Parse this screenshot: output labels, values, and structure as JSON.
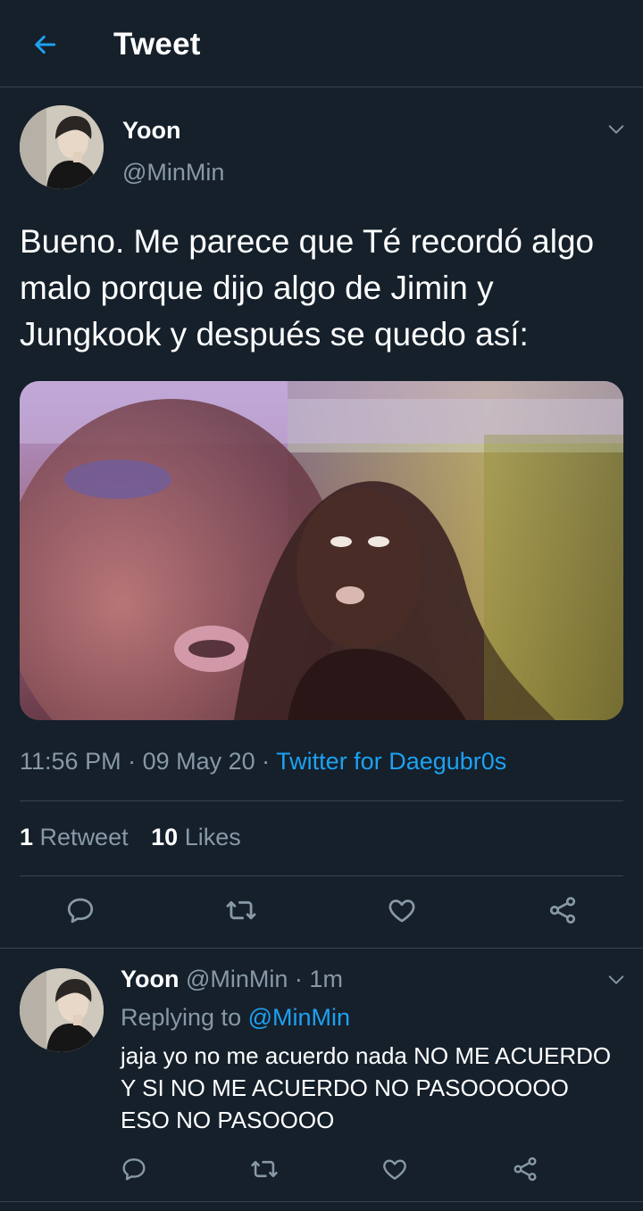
{
  "header": {
    "title": "Tweet"
  },
  "tweet": {
    "author_name": "Yoon",
    "author_handle": "@MinMin",
    "text": "Bueno. Me parece que Té recordó algo malo porque dijo algo de Jimin y Jungkook y después se quedo así:",
    "time": "11:56 PM",
    "date": "09 May 20",
    "source": "Twitter for Daegubr0s",
    "retweets_count": "1",
    "retweets_label": "Retweet",
    "likes_count": "10",
    "likes_label": "Likes"
  },
  "reply": {
    "author_name": "Yoon",
    "author_handle": "@MinMin",
    "time_ago": "1m",
    "replying_label": "Replying to",
    "replying_handle": "@MinMin",
    "text": "jaja yo no me acuerdo nada NO ME ACUERDO Y SI NO ME ACUERDO NO PASOOOOOO ESO NO PASOOOO"
  },
  "colors": {
    "background": "#15202b",
    "accent": "#1da1f2",
    "secondary_text": "#8899a6",
    "divider": "#38444d"
  },
  "icons": {
    "back": "arrow-left-icon",
    "caret": "chevron-down-icon",
    "reply": "reply-bubble-icon",
    "retweet": "retweet-icon",
    "like": "heart-icon",
    "share": "share-icon"
  }
}
